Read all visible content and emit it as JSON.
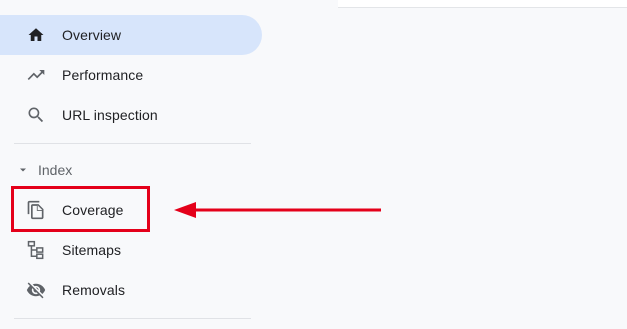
{
  "nav": {
    "items": [
      {
        "label": "Overview",
        "icon": "home-icon",
        "active": true
      },
      {
        "label": "Performance",
        "icon": "trending-up-icon",
        "active": false
      },
      {
        "label": "URL inspection",
        "icon": "search-icon",
        "active": false
      }
    ],
    "section": {
      "label": "Index",
      "icon": "caret-down-icon",
      "items": [
        {
          "label": "Coverage",
          "icon": "copy-pages-icon",
          "highlighted": true
        },
        {
          "label": "Sitemaps",
          "icon": "sitemap-icon"
        },
        {
          "label": "Removals",
          "icon": "eye-off-icon"
        }
      ]
    }
  },
  "annotation": {
    "color": "#e4001a"
  },
  "colors": {
    "active_bg": "#d7e5fb",
    "icon": "#5f6368",
    "active_icon": "#202124",
    "text": "#202124"
  }
}
